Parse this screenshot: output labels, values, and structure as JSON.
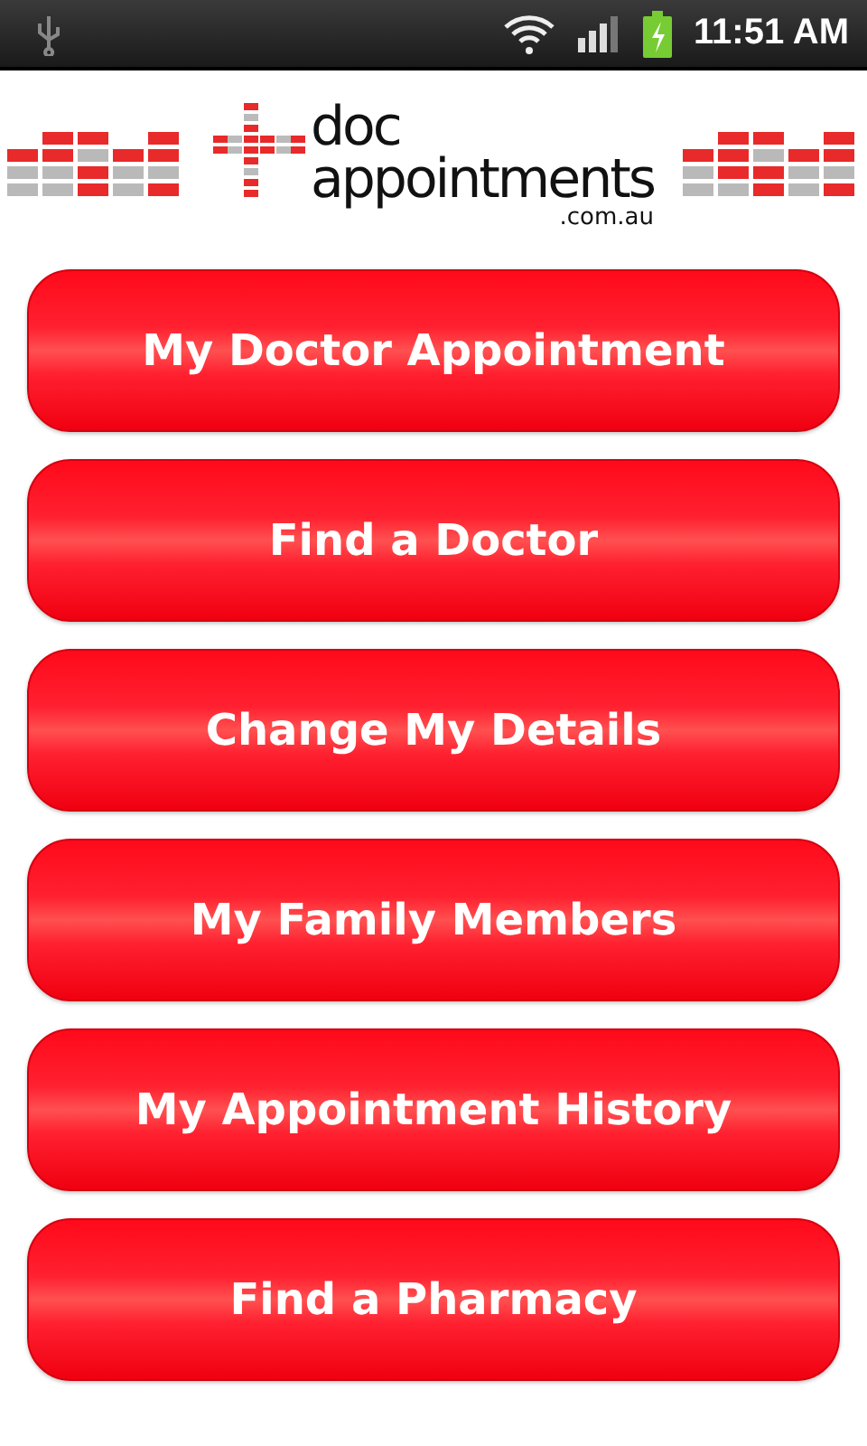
{
  "status_bar": {
    "time": "11:51 AM"
  },
  "logo": {
    "line_1": "doc",
    "line_2": "appointments",
    "line_3": ".com.au"
  },
  "menu_buttons": [
    {
      "label": "My Doctor Appointment"
    },
    {
      "label": "Find a Doctor"
    },
    {
      "label": "Change My Details"
    },
    {
      "label": "My Family Members"
    },
    {
      "label": "My Appointment History"
    },
    {
      "label": "Find a Pharmacy"
    }
  ]
}
